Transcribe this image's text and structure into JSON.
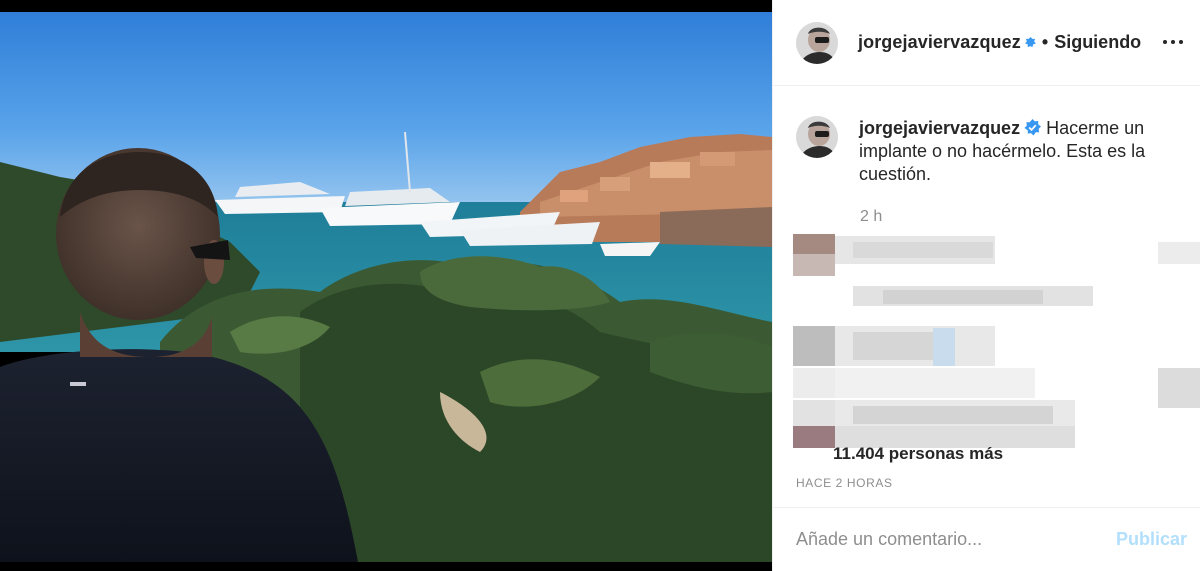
{
  "post": {
    "image_alt": "",
    "author": {
      "username": "jorgejaviervazquez",
      "verified": true
    },
    "header": {
      "separator": "•",
      "follow_status": "Siguiendo",
      "more_icon": "more-options-icon"
    },
    "caption": {
      "username": "jorgejaviervazquez",
      "text": "Hacerme un implante o no hacérmelo. Esta es la cuestión.",
      "time": "2 h"
    },
    "likes": "11.404 personas más",
    "age": "HACE 2 HORAS"
  },
  "comment_bar": {
    "placeholder": "Añade un comentario...",
    "publish_label": "Publicar"
  },
  "colors": {
    "text": "#262626",
    "muted": "#8e8e8e",
    "verified": "#3897f0",
    "publish_disabled": "#b2dffc",
    "border": "#efefef"
  }
}
